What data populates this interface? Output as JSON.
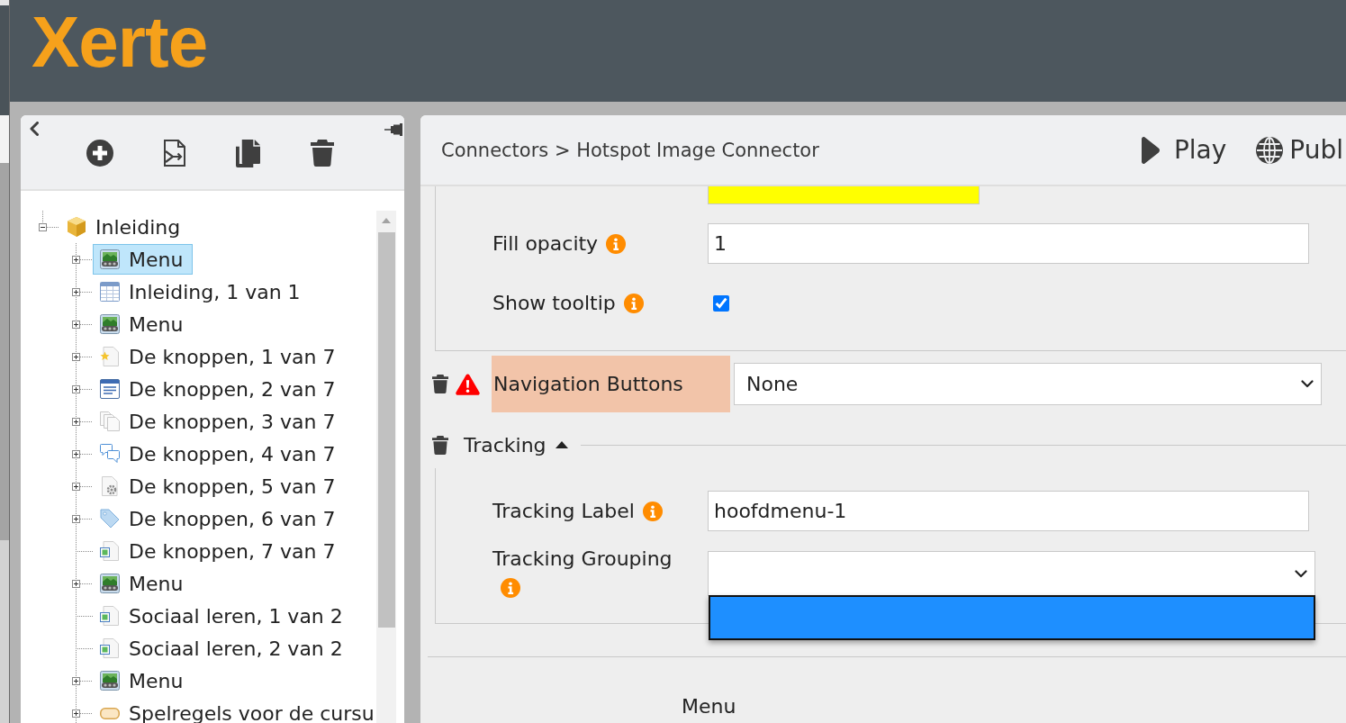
{
  "logo": "Xerte",
  "tree": {
    "label": "Inleiding",
    "kind": "module",
    "expanded": true,
    "selected": false,
    "children": [
      {
        "label": "Menu",
        "kind": "menu",
        "expandable": true,
        "selected": true
      },
      {
        "label": "Inleiding, 1 van 1",
        "kind": "table",
        "expandable": true,
        "selected": false
      },
      {
        "label": "Menu",
        "kind": "menu",
        "expandable": true,
        "selected": false
      },
      {
        "label": "De knoppen, 1 van 7",
        "kind": "star-page",
        "expandable": true,
        "selected": false
      },
      {
        "label": "De knoppen, 2 van 7",
        "kind": "text-window",
        "expandable": true,
        "selected": false
      },
      {
        "label": "De knoppen, 3 van 7",
        "kind": "pages",
        "expandable": true,
        "selected": false
      },
      {
        "label": "De knoppen, 4 van 7",
        "kind": "speech",
        "expandable": true,
        "selected": false
      },
      {
        "label": "De knoppen, 5 van 7",
        "kind": "gear-page",
        "expandable": true,
        "selected": false
      },
      {
        "label": "De knoppen, 6 van 7",
        "kind": "tag",
        "expandable": true,
        "selected": false
      },
      {
        "label": "De knoppen, 7 van 7",
        "kind": "image-page",
        "expandable": false,
        "selected": false
      },
      {
        "label": "Menu",
        "kind": "menu",
        "expandable": true,
        "selected": false
      },
      {
        "label": "Sociaal leren, 1 van 2",
        "kind": "image-page",
        "expandable": false,
        "selected": false
      },
      {
        "label": "Sociaal leren, 2 van 2",
        "kind": "image-page",
        "expandable": false,
        "selected": false
      },
      {
        "label": "Menu",
        "kind": "menu",
        "expandable": true,
        "selected": false
      },
      {
        "label": "Spelregels voor de cursu",
        "kind": "button",
        "expandable": true,
        "selected": false
      }
    ]
  },
  "editor": {
    "breadcrumb": "Connectors > Hotspot Image Connector",
    "actions": [
      {
        "kind": "play",
        "label": "Play"
      },
      {
        "kind": "publish",
        "label": "Publ"
      }
    ],
    "appearance_fields": [
      {
        "kind": "colour",
        "color": "#ffff00"
      },
      {
        "kind": "text",
        "label": "Fill opacity",
        "value": "1"
      },
      {
        "kind": "checkbox",
        "label": "Show tooltip",
        "checked": true
      }
    ],
    "navigation": {
      "label": "Navigation Buttons",
      "value": "None",
      "warning": true
    },
    "tracking": {
      "title": "Tracking",
      "expanded": true,
      "fields": [
        {
          "kind": "text",
          "label": "Tracking Label",
          "value": "hoofdmenu-1"
        },
        {
          "kind": "select",
          "label": "Tracking Grouping",
          "open": true,
          "options": [
            {
              "selected": true
            }
          ]
        }
      ]
    },
    "section_title": "Menu"
  }
}
